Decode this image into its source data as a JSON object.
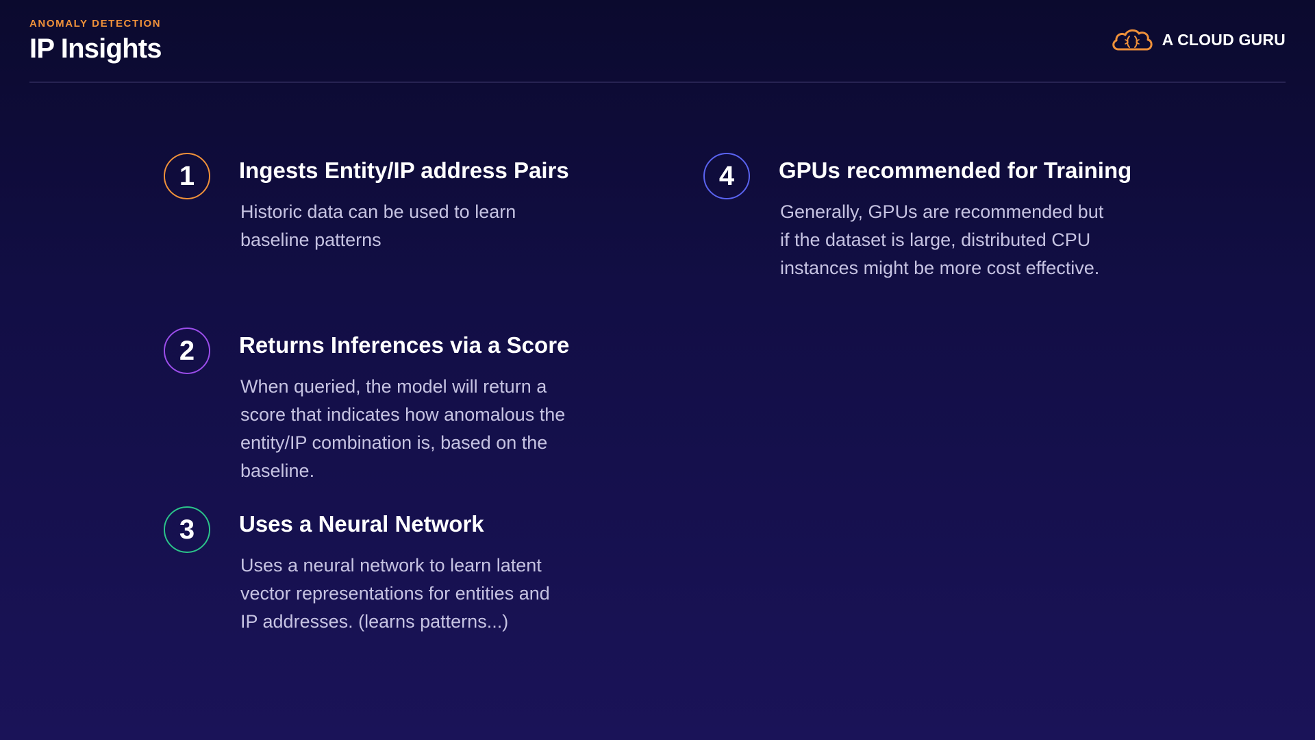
{
  "header": {
    "eyebrow": "ANOMALY DETECTION",
    "title": "IP Insights"
  },
  "brand": {
    "name": "A CLOUD GURU",
    "icon": "cloud-logo-icon",
    "color": "#f0913a"
  },
  "items": [
    {
      "number": "1",
      "color": "#f0913a",
      "title": "Ingests Entity/IP address Pairs",
      "lines": [
        "Historic data can be used to learn",
        "baseline patterns"
      ]
    },
    {
      "number": "2",
      "color": "#9b4dea",
      "title": "Returns Inferences via a Score",
      "lines": [
        "When queried, the model will return a",
        "score that indicates how anomalous the",
        "entity/IP combination is, based on the",
        "baseline."
      ]
    },
    {
      "number": "3",
      "color": "#2bc48a",
      "title": "Uses a Neural Network",
      "lines": [
        "Uses a neural network to learn latent",
        "vector representations for entities and",
        "IP addresses.  (learns patterns...)"
      ]
    },
    {
      "number": "4",
      "color": "#5a63f0",
      "title": "GPUs recommended for Training",
      "lines": [
        "Generally, GPUs are recommended but",
        "if the dataset is large, distributed CPU",
        "instances might be more cost effective."
      ]
    }
  ]
}
